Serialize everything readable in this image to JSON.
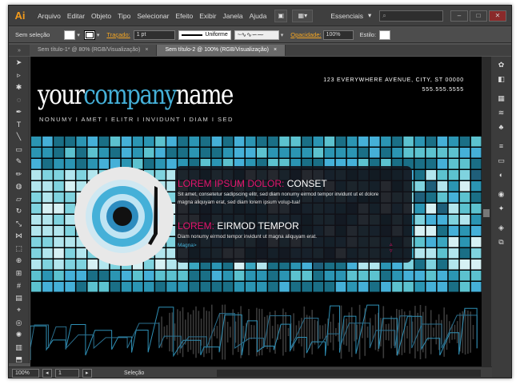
{
  "menubar": {
    "logo": "Ai",
    "items": [
      "Arquivo",
      "Editar",
      "Objeto",
      "Tipo",
      "Selecionar",
      "Efeito",
      "Exibir",
      "Janela",
      "Ajuda"
    ],
    "workspace": "Essenciais",
    "window_controls": [
      "–",
      "□",
      "✕"
    ]
  },
  "controlbar": {
    "selection_label": "Sem seleção",
    "stroke_label": "Traçado:",
    "stroke_value": "1 pt",
    "profile": "Uniforme",
    "opacity_label": "Opacidade:",
    "opacity_value": "100%",
    "style_label": "Estilo:"
  },
  "tabs": [
    {
      "label": "Sem título-1* @ 80% (RGB/Visualização)",
      "close": "×",
      "active": false
    },
    {
      "label": "Sem título-2 @ 100% (RGB/Visualização)",
      "close": "×",
      "active": true
    }
  ],
  "artwork": {
    "company_a": "your",
    "company_b": "company",
    "company_c": "name",
    "nav": "NONUMY  I  AMET  I  ELITR  I  INVIDUNT  I  DIAM  I  SED",
    "address_line1": "123 EVERYWHERE AVENUE, CITY, ST 00000",
    "address_line2": "555.555.5555",
    "heading1_accent": "LOREM IPSUM DOLOR:",
    "heading1_rest": " CONSET",
    "body1": "Sit amet, consetetur sadipscing elitr,  sed diam nonumy eirmod tempor invidunt ut et dolore magna aliquyam erat, sed diam lorem ipsum volup-tua!",
    "heading2_accent": "LOREM:",
    "heading2_rest": " EIRMOD TEMPOR",
    "body2": "Diam nonumy eirmod tempor invidunt ut magna aliquyam erat.",
    "more_link": "Magna>"
  },
  "statusbar": {
    "zoom": "100%",
    "artboard": "1",
    "mode": "Seleção"
  },
  "colors": {
    "accent_blue": "#45b0d8",
    "accent_pink": "#e3146d",
    "app_orange": "#f39b1c"
  },
  "tools": [
    "selection-icon",
    "direct-selection-icon",
    "magic-wand-icon",
    "lasso-icon",
    "pen-icon",
    "type-icon",
    "line-icon",
    "rectangle-icon",
    "paintbrush-icon",
    "pencil-icon",
    "blob-brush-icon",
    "eraser-icon",
    "rotate-icon",
    "scale-icon",
    "width-icon",
    "free-transform-icon",
    "shape-builder-icon",
    "perspective-icon",
    "mesh-icon",
    "gradient-icon",
    "eyedropper-icon",
    "blend-icon",
    "symbol-sprayer-icon",
    "graph-icon",
    "artboard-icon",
    "slice-icon",
    "hand-icon",
    "zoom-icon"
  ],
  "panels": [
    "color-guide-icon",
    "color-icon",
    "swatches-icon",
    "brushes-icon",
    "symbols-icon",
    "stroke-icon",
    "gradient-icon",
    "transparency-icon",
    "appearance-icon",
    "graphic-styles-icon",
    "layers-icon",
    "artboards-icon"
  ]
}
